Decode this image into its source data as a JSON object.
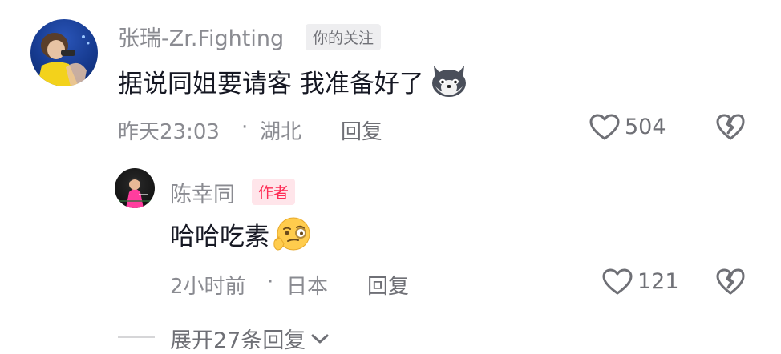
{
  "comment": {
    "username": "张瑞-Zr.Fighting",
    "follow_tag": "你的关注",
    "text": "据说同姐要请客 我准备好了",
    "emoji": "husky-emoji",
    "time": "昨天23:03",
    "dot": "·",
    "location": "湖北",
    "reply_label": "回复",
    "like_count": "504",
    "like_icon": "heart-outline-icon",
    "dislike_icon": "broken-heart-icon"
  },
  "reply": {
    "username": "陈幸同",
    "author_tag": "作者",
    "text": "哈哈吃素",
    "emoji": "thinking-nerd-emoji",
    "time": "2小时前",
    "dot": "·",
    "location": "日本",
    "reply_label": "回复",
    "like_count": "121",
    "like_icon": "heart-outline-icon",
    "dislike_icon": "broken-heart-icon"
  },
  "expand": {
    "label": "展开27条回复",
    "icon": "chevron-down-icon"
  },
  "colors": {
    "primary_text": "#161823",
    "secondary_text": "#8a8b91",
    "author_tag": "#fe2c55",
    "author_tag_bg": "#ffe5ea",
    "follow_tag_bg": "#eeeef0"
  }
}
